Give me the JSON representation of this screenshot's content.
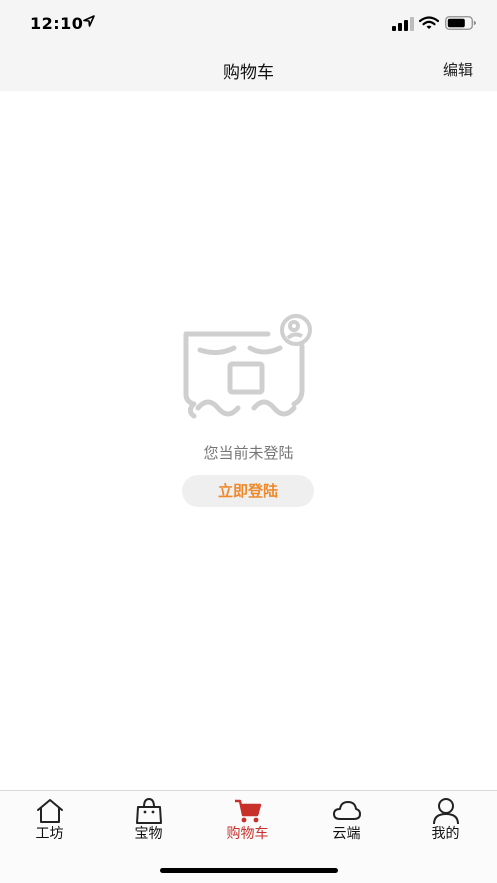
{
  "status_bar": {
    "time": "12:10"
  },
  "nav": {
    "title": "购物车",
    "edit_label": "编辑"
  },
  "empty_state": {
    "message": "您当前未登陆",
    "login_label": "立即登陆"
  },
  "colors": {
    "accent": "#c8302a",
    "login_text": "#ef8a2c",
    "bar_background": "#f5f5f5"
  },
  "tabs": [
    {
      "label": "工坊",
      "icon": "home-icon",
      "active": false
    },
    {
      "label": "宝物",
      "icon": "shopping-bag-icon",
      "active": false
    },
    {
      "label": "购物车",
      "icon": "cart-icon",
      "active": true
    },
    {
      "label": "云端",
      "icon": "cloud-icon",
      "active": false
    },
    {
      "label": "我的",
      "icon": "user-icon",
      "active": false
    }
  ]
}
